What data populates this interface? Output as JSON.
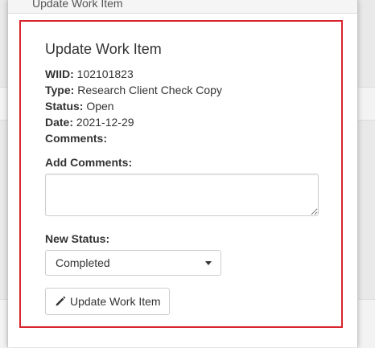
{
  "modal": {
    "header_title": "Update Work Item"
  },
  "panel": {
    "title": "Update Work Item",
    "border_color": "#d9252d",
    "info": {
      "wiid_label": "WIID:",
      "wiid_value": "102101823",
      "type_label": "Type:",
      "type_value": "Research Client Check Copy",
      "status_label": "Status:",
      "status_value": "Open",
      "date_label": "Date:",
      "date_value": "2021-12-29",
      "comments_label": "Comments:",
      "comments_value": ""
    },
    "add_comments": {
      "label": "Add Comments:",
      "value": ""
    },
    "new_status": {
      "label": "New Status:",
      "selected": "Completed"
    },
    "update_button": {
      "label": "Update Work Item",
      "icon": "pencil-icon"
    }
  }
}
